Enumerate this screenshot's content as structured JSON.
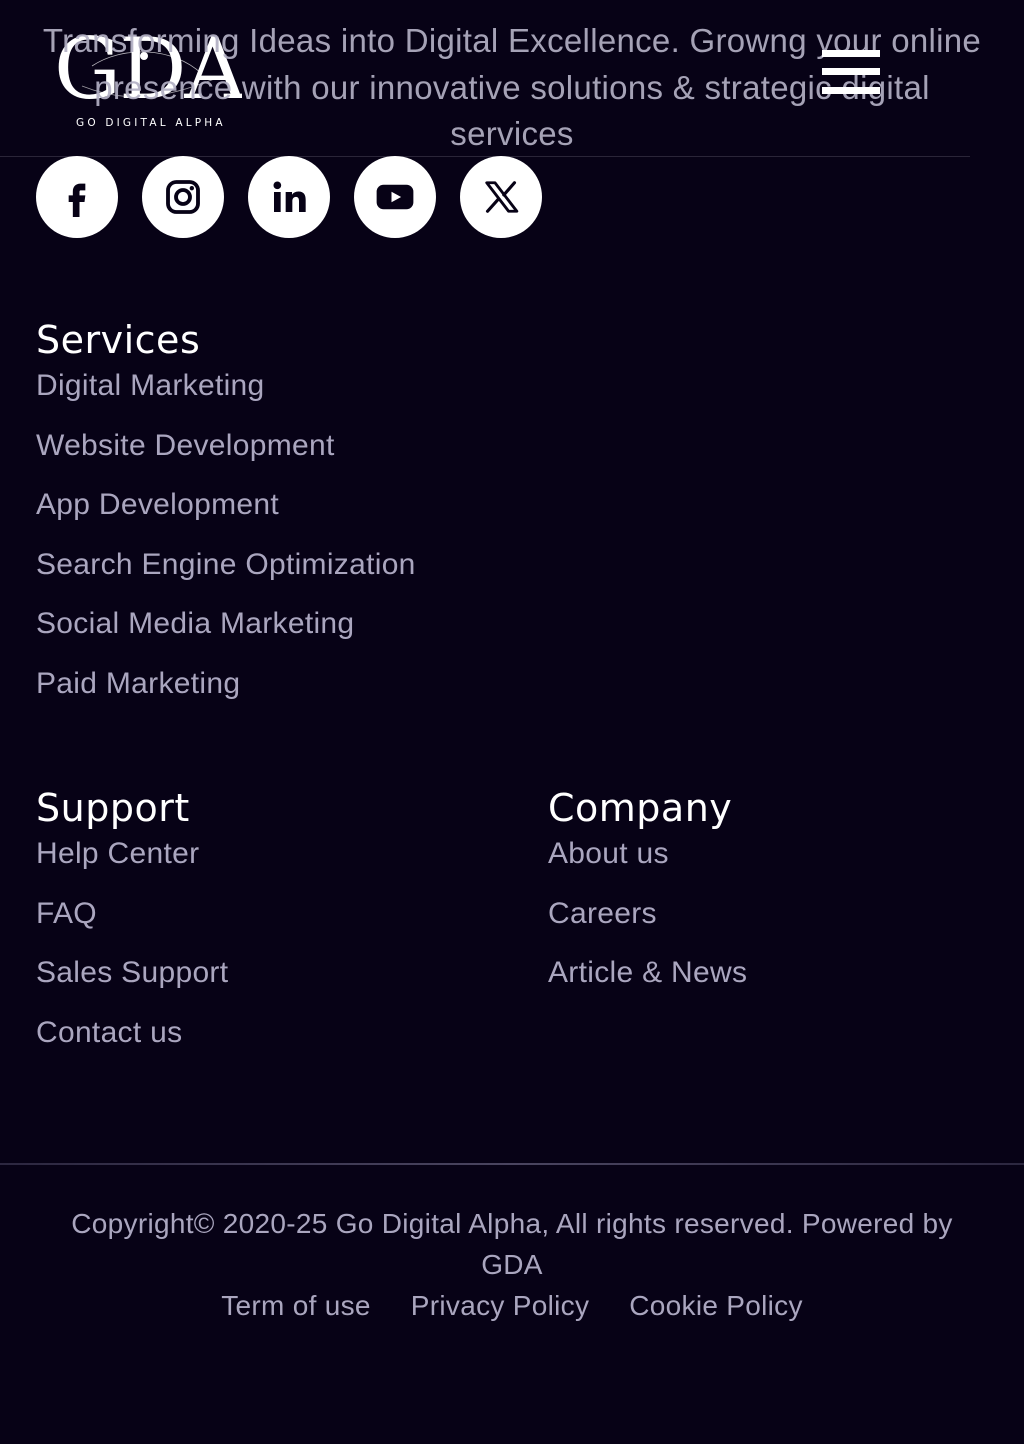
{
  "header": {
    "logo_text": "GDA",
    "logo_subtext": "GO DIGITAL ALPHA",
    "tagline": "Transforming Ideas into Digital Excellence. Growng your online presence with our innovative solutions & strategic digital services",
    "menu_icon": "hamburger-menu-icon"
  },
  "socials": [
    {
      "name": "facebook",
      "icon": "facebook-icon"
    },
    {
      "name": "instagram",
      "icon": "instagram-icon"
    },
    {
      "name": "linkedin",
      "icon": "linkedin-icon"
    },
    {
      "name": "youtube",
      "icon": "youtube-icon"
    },
    {
      "name": "x",
      "icon": "x-twitter-icon"
    }
  ],
  "services": {
    "title": "Services",
    "items": [
      "Digital Marketing",
      "Website Development",
      "App Development",
      "Search Engine Optimization",
      "Social Media Marketing",
      "Paid Marketing"
    ]
  },
  "support": {
    "title": "Support",
    "items": [
      "Help Center",
      "FAQ",
      "Sales Support",
      "Contact us"
    ]
  },
  "company": {
    "title": "Company",
    "items": [
      "About us",
      "Careers",
      "Article & News"
    ]
  },
  "footer": {
    "copyright": "Copyright© 2020-25 Go Digital Alpha, All rights reserved. Powered by GDA",
    "legal_links": [
      "Term of use",
      "Privacy Policy",
      "Cookie Policy"
    ]
  },
  "colors": {
    "background": "#070216",
    "heading": "#ffffff",
    "link": "#aaa6bf",
    "icon_circle": "#ffffff"
  }
}
